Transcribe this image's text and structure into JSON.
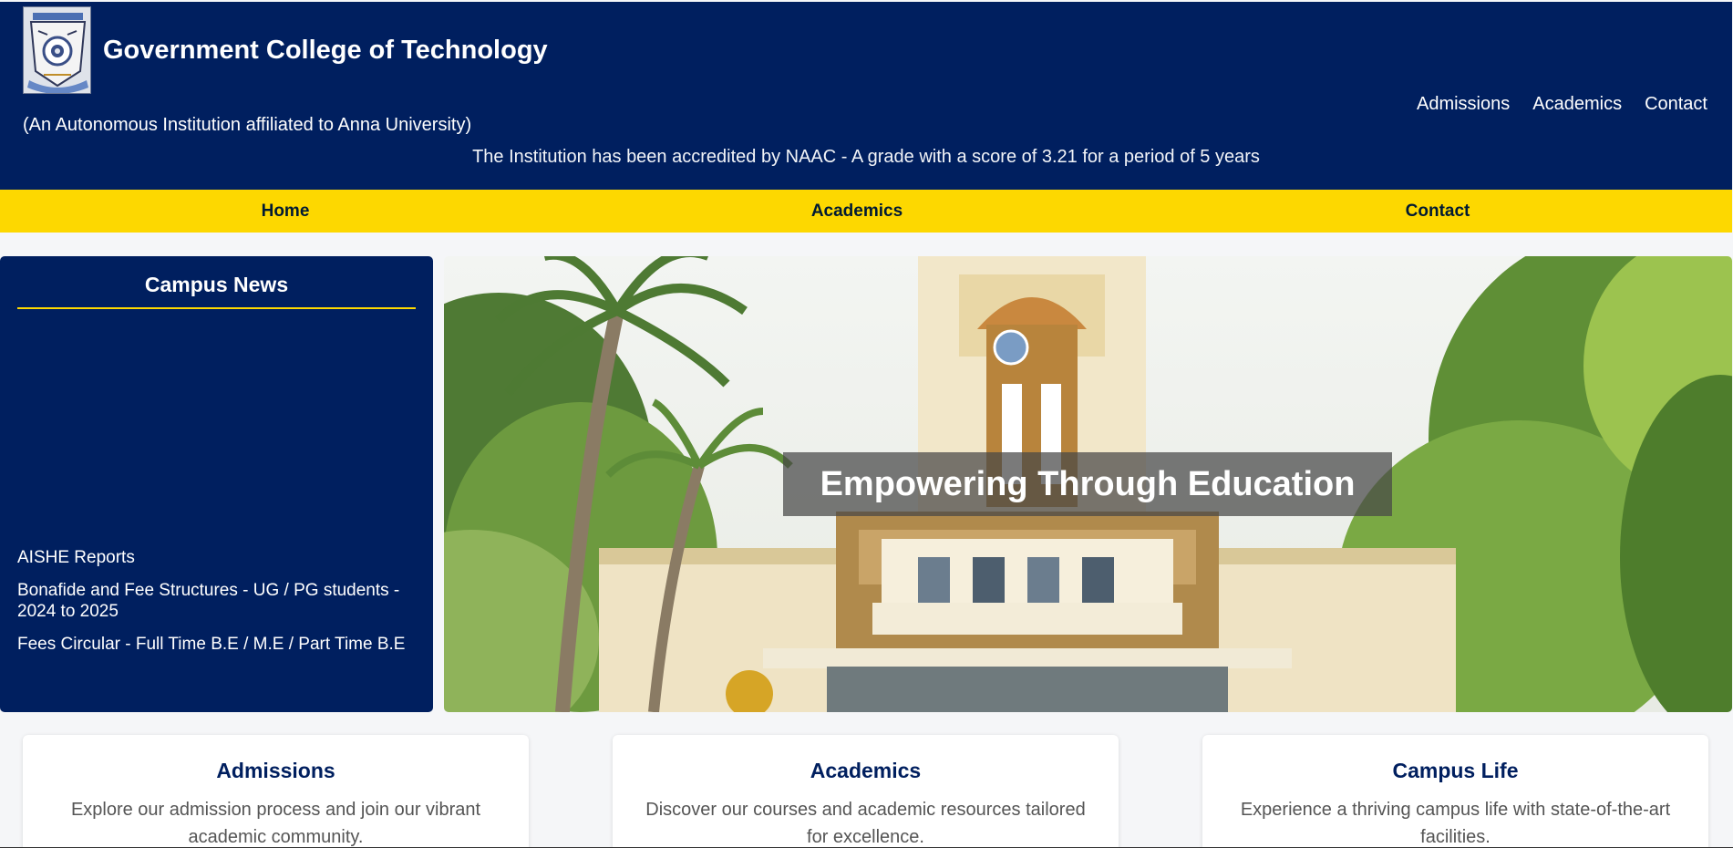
{
  "header": {
    "title": "Government College of Technology",
    "subtitle": "(An Autonomous Institution affiliated to Anna University)",
    "accreditation": "The Institution has been accredited by NAAC - A grade with a score of 3.21 for a period of 5 years",
    "links": [
      "Admissions",
      "Academics",
      "Contact"
    ],
    "logo_icon": "college-emblem-icon"
  },
  "nav": {
    "items": [
      "Home",
      "Academics",
      "Contact"
    ]
  },
  "news": {
    "title": "Campus News",
    "items": [
      "AISHE Reports",
      "Bonafide and Fee Structures - UG / PG students - 2024 to 2025",
      "Fees Circular - Full Time B.E / M.E / Part Time B.E"
    ]
  },
  "hero": {
    "caption": "Empowering Through Education"
  },
  "cards": [
    {
      "title": "Admissions",
      "text": "Explore our admission process and join our vibrant academic community."
    },
    {
      "title": "Academics",
      "text": "Discover our courses and academic resources tailored for excellence."
    },
    {
      "title": "Campus Life",
      "text": "Experience a thriving campus life with state-of-the-art facilities."
    }
  ],
  "colors": {
    "primary": "#001f5f",
    "accent": "#fdd800"
  }
}
